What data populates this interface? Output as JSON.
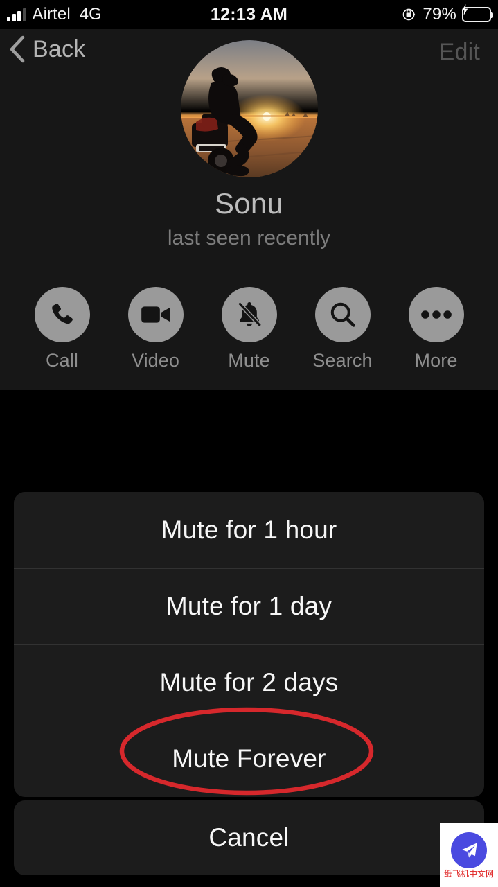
{
  "status_bar": {
    "carrier": "Airtel",
    "network": "4G",
    "time": "12:13 AM",
    "battery_percent": "79%",
    "signal_icon": "signal-bars-icon",
    "rotation_lock_icon": "rotation-lock-icon",
    "battery_icon": "battery-charging-icon",
    "battery_color": "#3ad94a",
    "signal_bars": 4,
    "signal_bars_active": 3
  },
  "nav": {
    "back_label": "Back",
    "back_icon": "chevron-left-icon",
    "edit_label": "Edit"
  },
  "profile": {
    "name": "Sonu",
    "status": "last seen recently",
    "avatar_description": "motorcycle-sunset-photo"
  },
  "actions": [
    {
      "label": "Call",
      "icon": "phone-icon"
    },
    {
      "label": "Video",
      "icon": "video-camera-icon"
    },
    {
      "label": "Mute",
      "icon": "bell-slash-icon"
    },
    {
      "label": "Search",
      "icon": "magnifier-icon"
    },
    {
      "label": "More",
      "icon": "ellipsis-icon"
    }
  ],
  "action_sheet": {
    "items": [
      {
        "label": "Mute for 1 hour",
        "highlighted": false
      },
      {
        "label": "Mute for 1 day",
        "highlighted": false
      },
      {
        "label": "Mute for 2 days",
        "highlighted": false
      },
      {
        "label": "Mute Forever",
        "highlighted": true
      }
    ],
    "cancel_label": "Cancel"
  },
  "annotation": {
    "shape": "ellipse",
    "color": "#d6282c",
    "target": "Mute Forever"
  },
  "watermark": {
    "text": "纸飞机中文网",
    "icon": "paper-plane-icon",
    "circle_color": "#4a4ae0",
    "text_color": "#e02020"
  }
}
